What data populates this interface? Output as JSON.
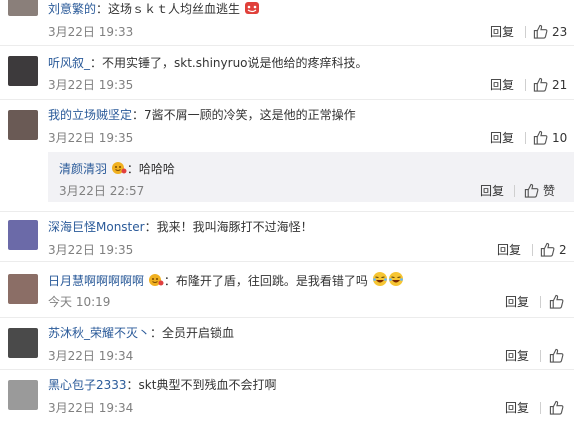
{
  "comments": [
    {
      "user": "刘意繁的",
      "text": "：这场ｓｋｔ人均丝血逃生",
      "time": "3月22日 19:33",
      "reply": "回复",
      "likes": "23"
    },
    {
      "user": "听风叙_",
      "text": "：不用实锤了，skt.shinyruo说是他给的疼痒科技。",
      "time": "3月22日 19:35",
      "reply": "回复",
      "likes": "21"
    },
    {
      "user": "我的立场贼坚定",
      "text": "：7酱不屑一顾的冷笑，这是他的正常操作",
      "time": "3月22日 19:35",
      "reply": "回复",
      "likes": "10"
    },
    {
      "user": "深海巨怪Monster",
      "text": "：我来！我叫海豚打不过海怪！",
      "time": "3月22日 19:35",
      "reply": "回复",
      "likes": "2"
    },
    {
      "user": "日月慧啊啊啊啊啊",
      "text": "：布隆开了盾，往回跳。是我看错了吗",
      "time": "今天 10:19",
      "reply": "回复",
      "likes": ""
    },
    {
      "user": "苏沐秋_荣耀不灭丶",
      "text": "：全员开启锁血",
      "time": "3月22日 19:34",
      "reply": "回复",
      "likes": ""
    },
    {
      "user": "黑心包子2333",
      "text": "：skt典型不到残血不会打啊",
      "time": "3月22日 19:34",
      "reply": "回复",
      "likes": ""
    }
  ],
  "subreply": {
    "user": "清颜清羽",
    "text": "：哈哈哈",
    "time": "3月22日 22:57",
    "reply": "回复",
    "likes": "赞"
  },
  "colors": {
    "username": "#2a5a99",
    "time": "#808080",
    "subbox": "#f2f2f5",
    "badge": "#f0b020"
  },
  "icons": [
    "thumbs-up-icon",
    "vip-badge-icon",
    "laughing-emoji-icon",
    "red-emoji-icon"
  ]
}
